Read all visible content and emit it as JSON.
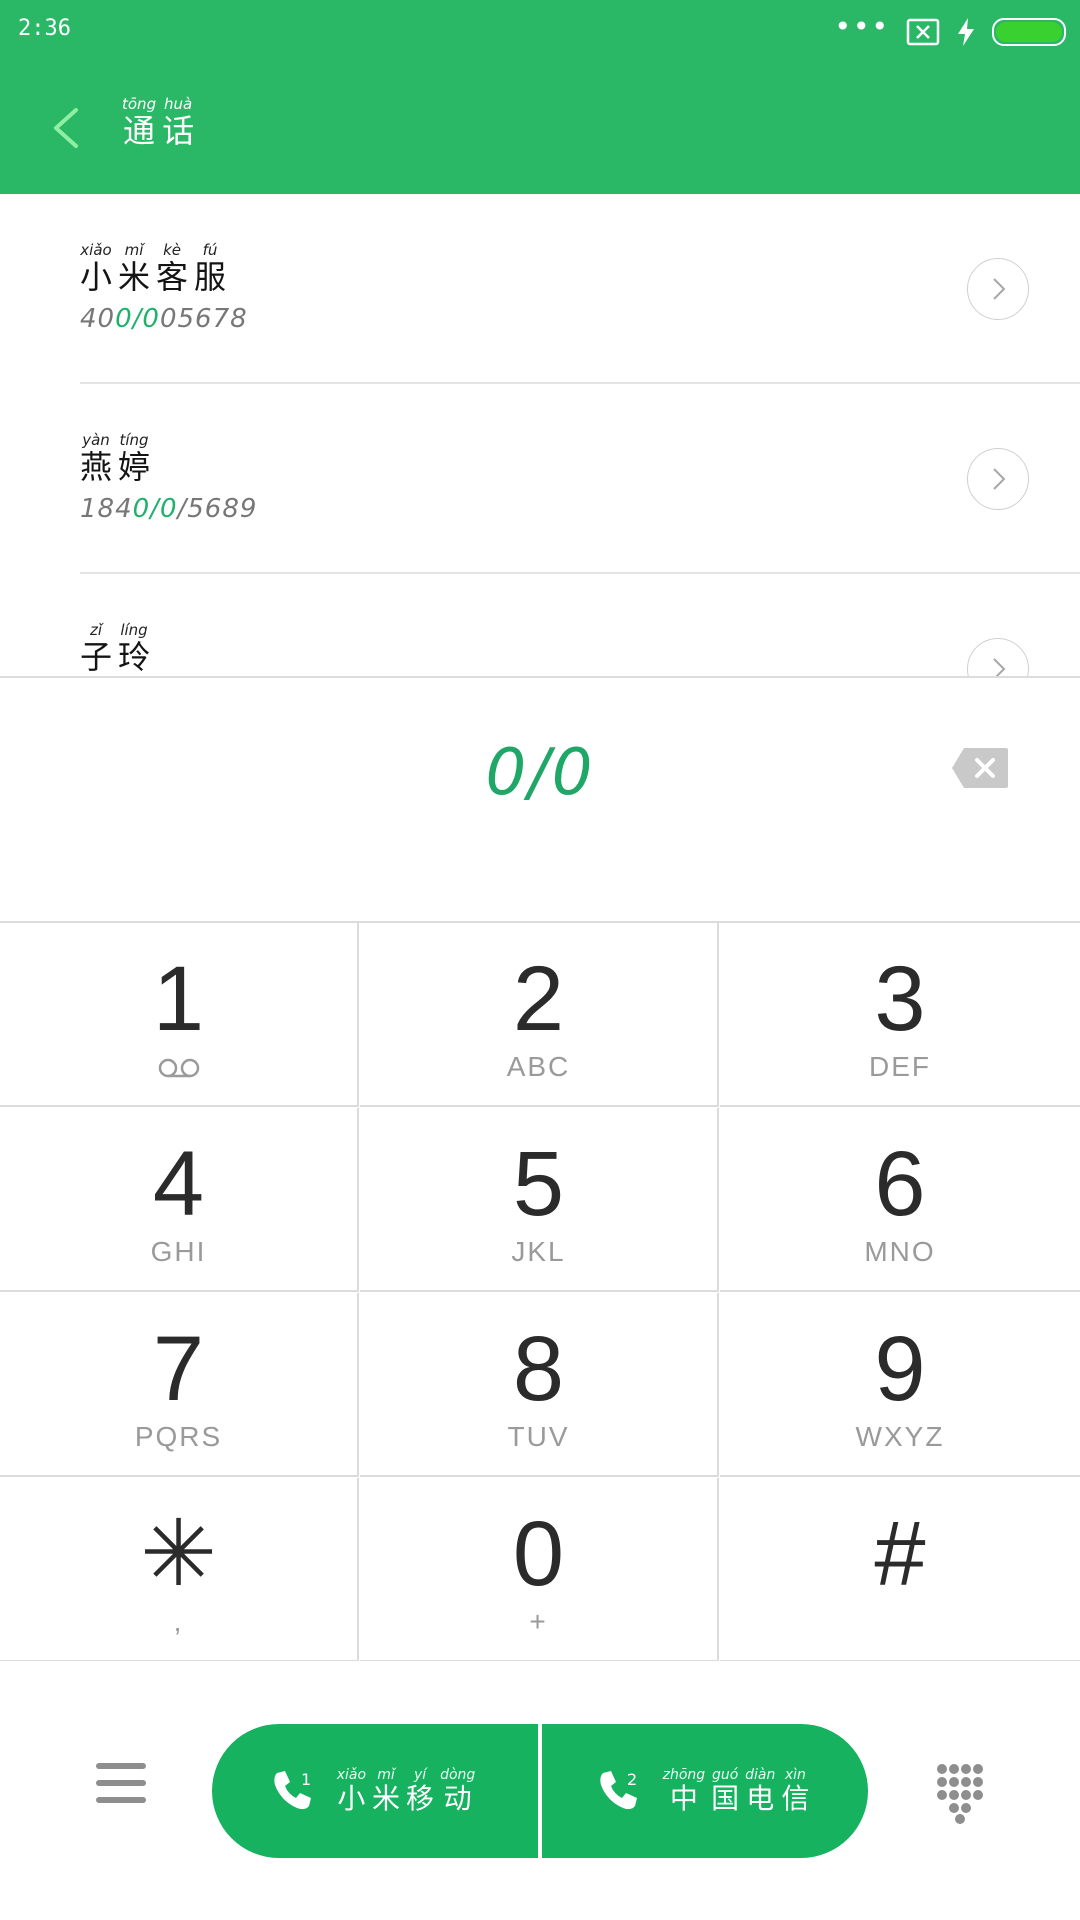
{
  "status_bar": {
    "time": "2:36",
    "icons": [
      "more-dots-icon",
      "no-sim-icon",
      "charging-bolt-icon",
      "battery-icon"
    ],
    "battery_level": 1.0,
    "overflow_dots": "•••"
  },
  "header": {
    "title": [
      {
        "py": "tōng",
        "hz": "通"
      },
      {
        "py": "huà",
        "hz": "话"
      }
    ]
  },
  "contacts": [
    {
      "name": [
        {
          "py": "xiǎo",
          "hz": "小"
        },
        {
          "py": "mǐ",
          "hz": "米"
        },
        {
          "py": "kè",
          "hz": "客"
        },
        {
          "py": "fú",
          "hz": "服"
        }
      ],
      "number_pre": "40",
      "number_match": "0/0",
      "number_post": "05678"
    },
    {
      "name": [
        {
          "py": "yàn",
          "hz": "燕"
        },
        {
          "py": "tíng",
          "hz": "婷"
        }
      ],
      "number_pre": "184",
      "number_match": "0/0",
      "number_post": "/5689"
    },
    {
      "name": [
        {
          "py": "zǐ",
          "hz": "子"
        },
        {
          "py": "líng",
          "hz": "玲"
        }
      ],
      "number_pre": "",
      "number_match": "",
      "number_post": ""
    }
  ],
  "dial_input": {
    "value": "0/0"
  },
  "keypad": [
    {
      "digit": "1",
      "letters": "voicemail"
    },
    {
      "digit": "2",
      "letters": "ABC"
    },
    {
      "digit": "3",
      "letters": "DEF"
    },
    {
      "digit": "4",
      "letters": "GHI"
    },
    {
      "digit": "5",
      "letters": "JKL"
    },
    {
      "digit": "6",
      "letters": "MNO"
    },
    {
      "digit": "7",
      "letters": "PQRS"
    },
    {
      "digit": "8",
      "letters": "TUV"
    },
    {
      "digit": "9",
      "letters": "WXYZ"
    },
    {
      "digit": "✳",
      "letters": ","
    },
    {
      "digit": "0",
      "letters": "+"
    },
    {
      "digit": "#",
      "letters": ""
    }
  ],
  "call_buttons": [
    {
      "sim": "1",
      "carrier": [
        {
          "py": "xiǎo",
          "hz": "小"
        },
        {
          "py": "mǐ",
          "hz": "米"
        },
        {
          "py": "yí",
          "hz": "移"
        },
        {
          "py": "dòng",
          "hz": "动"
        }
      ]
    },
    {
      "sim": "2",
      "carrier": [
        {
          "py": "zhōng",
          "hz": "中"
        },
        {
          "py": "guó",
          "hz": "国"
        },
        {
          "py": "diàn",
          "hz": "电"
        },
        {
          "py": "xìn",
          "hz": "信"
        }
      ]
    }
  ],
  "colors": {
    "brand_green": "#2ab766",
    "call_green": "#16b25f",
    "match_green": "#1fb26a"
  }
}
